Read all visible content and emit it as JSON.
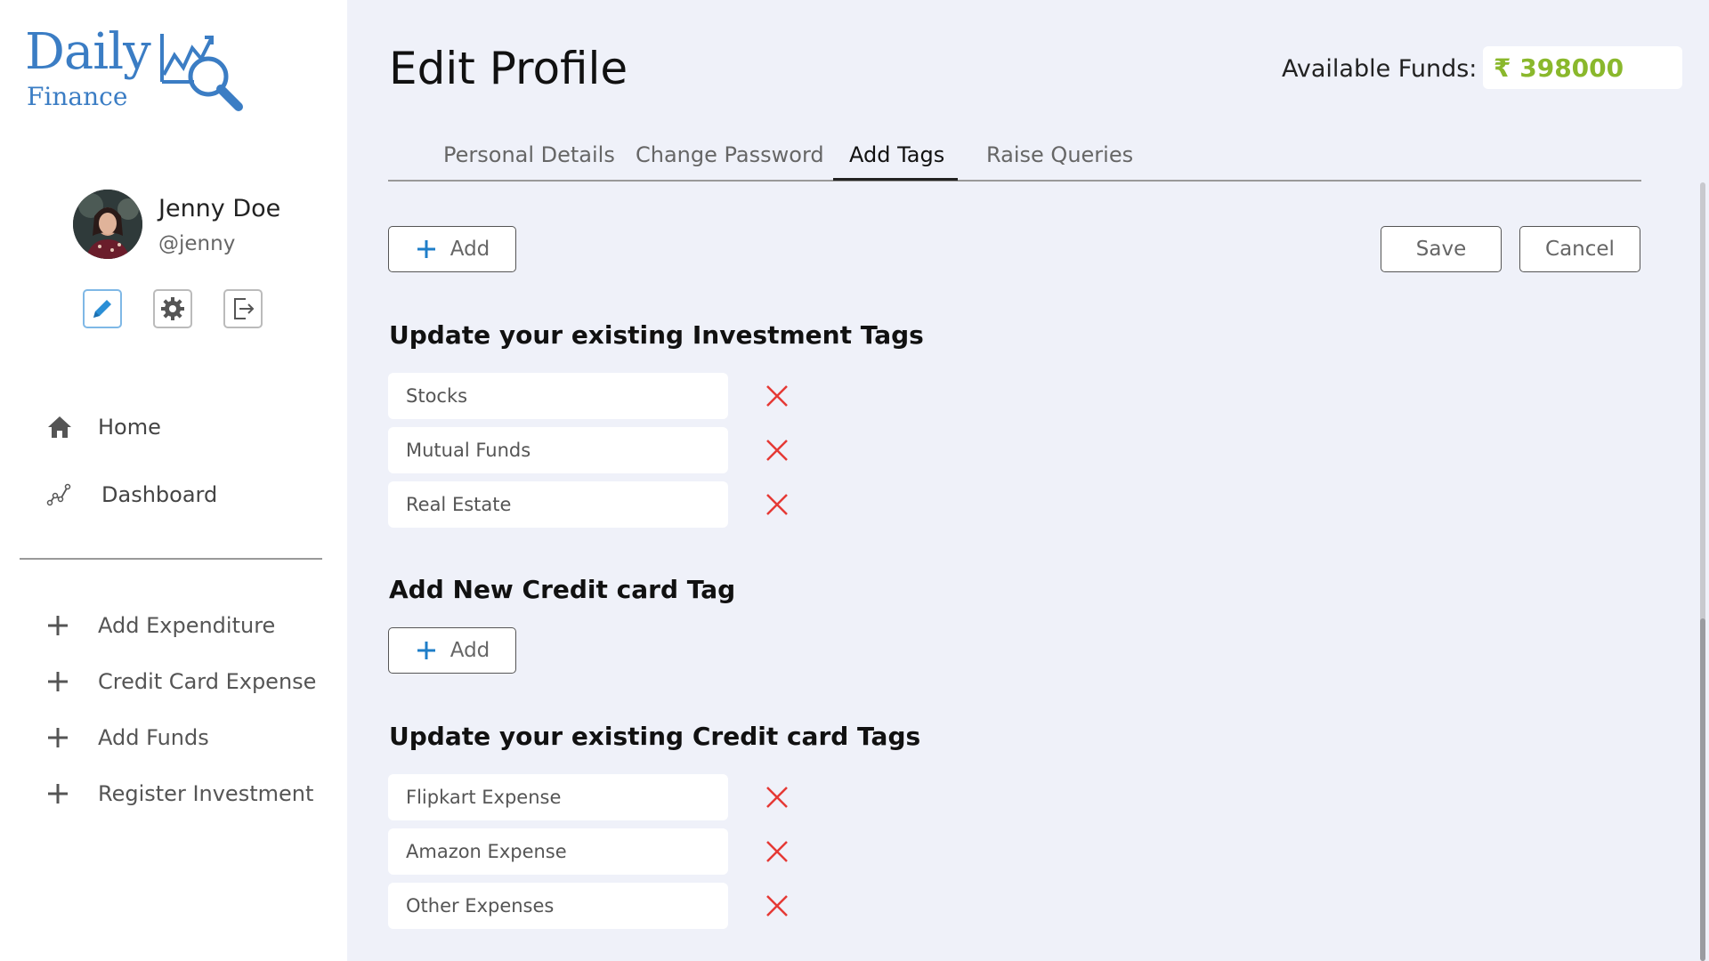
{
  "app": {
    "logo_line1": "Daily",
    "logo_line2": "Finance",
    "brand_color": "#3b7dc4"
  },
  "user": {
    "name": "Jenny Doe",
    "handle": "@jenny"
  },
  "profile_actions": [
    {
      "icon": "pencil-icon",
      "active": true
    },
    {
      "icon": "gear-icon",
      "active": false
    },
    {
      "icon": "logout-icon",
      "active": false
    }
  ],
  "nav": [
    {
      "label": "Home",
      "icon": "home-icon"
    },
    {
      "label": "Dashboard",
      "icon": "chart-line-icon"
    }
  ],
  "actions": [
    {
      "label": "Add Expenditure"
    },
    {
      "label": "Credit Card Expense"
    },
    {
      "label": "Add Funds"
    },
    {
      "label": "Register Investment"
    }
  ],
  "header": {
    "title": "Edit Profile",
    "funds_label": "Available Funds:",
    "funds_value": "₹ 398000",
    "funds_color": "#8ab82c"
  },
  "tabs": [
    {
      "label": "Personal Details",
      "active": false
    },
    {
      "label": "Change Password",
      "active": false
    },
    {
      "label": "Add Tags",
      "active": true
    },
    {
      "label": "Raise Queries",
      "active": false
    }
  ],
  "buttons": {
    "add_label": "Add",
    "save_label": "Save",
    "cancel_label": "Cancel"
  },
  "investment_section": {
    "title": "Update your existing Investment Tags",
    "tags": [
      "Stocks",
      "Mutual Funds",
      "Real Estate"
    ]
  },
  "credit_new_section": {
    "title": "Add New Credit card Tag"
  },
  "credit_section": {
    "title": "Update your existing Credit card Tags",
    "tags": [
      "Flipkart Expense",
      "Amazon Expense",
      "Other Expenses"
    ]
  },
  "colors": {
    "delete": "#e53935",
    "add_plus": "#1f7ec8"
  }
}
